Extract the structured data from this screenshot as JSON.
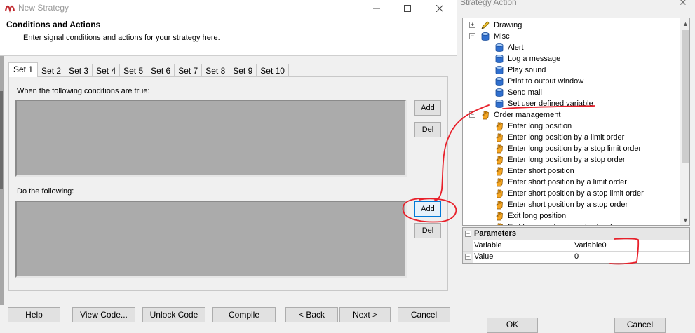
{
  "main_window": {
    "title": "New Strategy",
    "header_title": "Conditions and Actions",
    "header_subtitle": "Enter signal conditions and actions for your strategy here.",
    "tabs": [
      "Set 1",
      "Set 2",
      "Set 3",
      "Set 4",
      "Set 5",
      "Set 6",
      "Set 7",
      "Set 8",
      "Set 9",
      "Set 10"
    ],
    "conditions_label": "When the following conditions are true:",
    "actions_label": "Do the following:",
    "add_label": "Add",
    "del_label": "Del",
    "footer_buttons": {
      "help": "Help",
      "view_code": "View Code...",
      "unlock_code": "Unlock Code",
      "compile": "Compile",
      "back": "< Back",
      "next": "Next >",
      "cancel": "Cancel"
    }
  },
  "strategy_action_window": {
    "title": "Strategy Action",
    "tree": {
      "drawing": "Drawing",
      "misc": "Misc",
      "misc_items": [
        "Alert",
        "Log a message",
        "Play sound",
        "Print to output window",
        "Send mail",
        "Set user defined variable"
      ],
      "order_management": "Order management",
      "order_items": [
        "Enter long position",
        "Enter long position by a limit order",
        "Enter long position by a stop limit order",
        "Enter long position by a stop order",
        "Enter short position",
        "Enter short position by a limit order",
        "Enter short position by a stop limit order",
        "Enter short position by a stop order",
        "Exit long position",
        "Exit long position by a limit order"
      ]
    },
    "parameters": {
      "header": "Parameters",
      "rows": [
        {
          "name": "Variable",
          "value": "Variable0"
        },
        {
          "name": "Value",
          "value": "0"
        }
      ]
    },
    "ok_label": "OK",
    "cancel_label": "Cancel"
  },
  "colors": {
    "annotation": "#e8202a",
    "focus": "#0078d7",
    "panel_gray": "#ababab"
  }
}
